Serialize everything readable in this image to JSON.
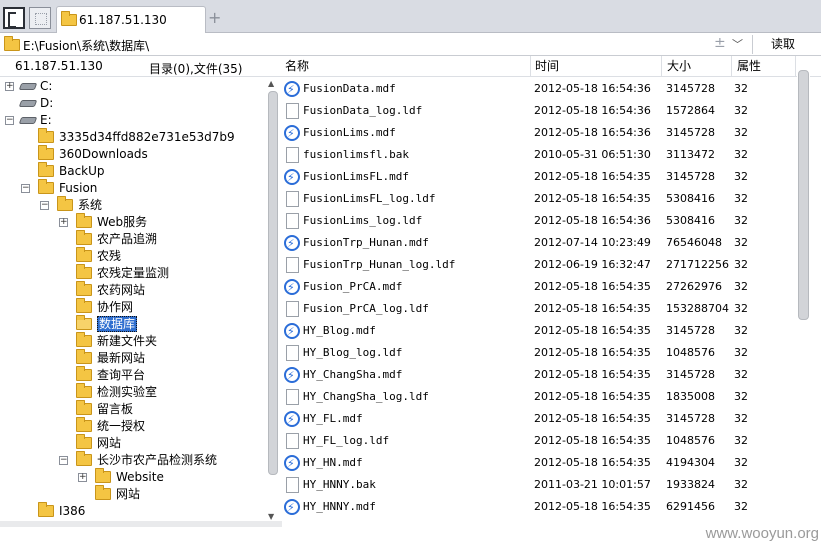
{
  "tabs": [
    {
      "label": "61.187.51.130"
    }
  ],
  "address": {
    "path": "E:\\Fusion\\系统\\数据库\\",
    "read_label": "读取"
  },
  "left_panel": {
    "host": "61.187.51.130",
    "counts": "目录(0),文件(35)"
  },
  "tree": [
    {
      "label": "C:",
      "type": "drive",
      "expander": "+"
    },
    {
      "label": "D:",
      "type": "drive",
      "expander": ""
    },
    {
      "label": "E:",
      "type": "drive",
      "expander": "−"
    },
    {
      "label": "3335d34ffd882e731e53d7b9",
      "type": "folder",
      "expander": ""
    },
    {
      "label": "360Downloads",
      "type": "folder",
      "expander": ""
    },
    {
      "label": "BackUp",
      "type": "folder",
      "expander": ""
    },
    {
      "label": "Fusion",
      "type": "folder",
      "expander": "−"
    },
    {
      "label": "系统",
      "type": "folder",
      "expander": "−"
    },
    {
      "label": "Web服务",
      "type": "folder",
      "expander": "+"
    },
    {
      "label": "农产品追溯",
      "type": "folder",
      "expander": ""
    },
    {
      "label": "农残",
      "type": "folder",
      "expander": ""
    },
    {
      "label": "农残定量监测",
      "type": "folder",
      "expander": ""
    },
    {
      "label": "农药网站",
      "type": "folder",
      "expander": ""
    },
    {
      "label": "协作网",
      "type": "folder",
      "expander": ""
    },
    {
      "label": "数据库",
      "type": "folder",
      "expander": "",
      "selected": true
    },
    {
      "label": "新建文件夹",
      "type": "folder",
      "expander": ""
    },
    {
      "label": "最新网站",
      "type": "folder",
      "expander": ""
    },
    {
      "label": "查询平台",
      "type": "folder",
      "expander": ""
    },
    {
      "label": "检测实验室",
      "type": "folder",
      "expander": ""
    },
    {
      "label": "留言板",
      "type": "folder",
      "expander": ""
    },
    {
      "label": "统一授权",
      "type": "folder",
      "expander": ""
    },
    {
      "label": "网站",
      "type": "folder",
      "expander": ""
    },
    {
      "label": "长沙市农产品检测系统",
      "type": "folder",
      "expander": "−"
    },
    {
      "label": "Website",
      "type": "folder",
      "expander": "+"
    },
    {
      "label": "网站",
      "type": "folder",
      "expander": ""
    },
    {
      "label": "I386",
      "type": "folder",
      "expander": ""
    }
  ],
  "columns": {
    "name": "名称",
    "time": "时间",
    "size": "大小",
    "attr": "属性"
  },
  "files": [
    {
      "name": "FusionData.mdf",
      "time": "2012-05-18 16:54:36",
      "size": "3145728",
      "attr": "32",
      "icon": "mdf"
    },
    {
      "name": "FusionData_log.ldf",
      "time": "2012-05-18 16:54:36",
      "size": "1572864",
      "attr": "32",
      "icon": "ldf"
    },
    {
      "name": "FusionLims.mdf",
      "time": "2012-05-18 16:54:36",
      "size": "3145728",
      "attr": "32",
      "icon": "mdf"
    },
    {
      "name": "fusionlimsfl.bak",
      "time": "2010-05-31 06:51:30",
      "size": "3113472",
      "attr": "32",
      "icon": "ldf"
    },
    {
      "name": "FusionLimsFL.mdf",
      "time": "2012-05-18 16:54:35",
      "size": "3145728",
      "attr": "32",
      "icon": "mdf"
    },
    {
      "name": "FusionLimsFL_log.ldf",
      "time": "2012-05-18 16:54:35",
      "size": "5308416",
      "attr": "32",
      "icon": "ldf"
    },
    {
      "name": "FusionLims_log.ldf",
      "time": "2012-05-18 16:54:36",
      "size": "5308416",
      "attr": "32",
      "icon": "ldf"
    },
    {
      "name": "FusionTrp_Hunan.mdf",
      "time": "2012-07-14 10:23:49",
      "size": "76546048",
      "attr": "32",
      "icon": "mdf"
    },
    {
      "name": "FusionTrp_Hunan_log.ldf",
      "time": "2012-06-19 16:32:47",
      "size": "271712256",
      "attr": "32",
      "icon": "ldf"
    },
    {
      "name": "Fusion_PrCA.mdf",
      "time": "2012-05-18 16:54:35",
      "size": "27262976",
      "attr": "32",
      "icon": "mdf"
    },
    {
      "name": "Fusion_PrCA_log.ldf",
      "time": "2012-05-18 16:54:35",
      "size": "153288704",
      "attr": "32",
      "icon": "ldf"
    },
    {
      "name": "HY_Blog.mdf",
      "time": "2012-05-18 16:54:35",
      "size": "3145728",
      "attr": "32",
      "icon": "mdf"
    },
    {
      "name": "HY_Blog_log.ldf",
      "time": "2012-05-18 16:54:35",
      "size": "1048576",
      "attr": "32",
      "icon": "ldf"
    },
    {
      "name": "HY_ChangSha.mdf",
      "time": "2012-05-18 16:54:35",
      "size": "3145728",
      "attr": "32",
      "icon": "mdf"
    },
    {
      "name": "HY_ChangSha_log.ldf",
      "time": "2012-05-18 16:54:35",
      "size": "1835008",
      "attr": "32",
      "icon": "ldf"
    },
    {
      "name": "HY_FL.mdf",
      "time": "2012-05-18 16:54:35",
      "size": "3145728",
      "attr": "32",
      "icon": "mdf"
    },
    {
      "name": "HY_FL_log.ldf",
      "time": "2012-05-18 16:54:35",
      "size": "1048576",
      "attr": "32",
      "icon": "ldf"
    },
    {
      "name": "HY_HN.mdf",
      "time": "2012-05-18 16:54:35",
      "size": "4194304",
      "attr": "32",
      "icon": "mdf"
    },
    {
      "name": "HY_HNNY.bak",
      "time": "2011-03-21 10:01:57",
      "size": "1933824",
      "attr": "32",
      "icon": "ldf"
    },
    {
      "name": "HY_HNNY.mdf",
      "time": "2012-05-18 16:54:35",
      "size": "6291456",
      "attr": "32",
      "icon": "mdf"
    }
  ],
  "watermark": "www.wooyun.org"
}
